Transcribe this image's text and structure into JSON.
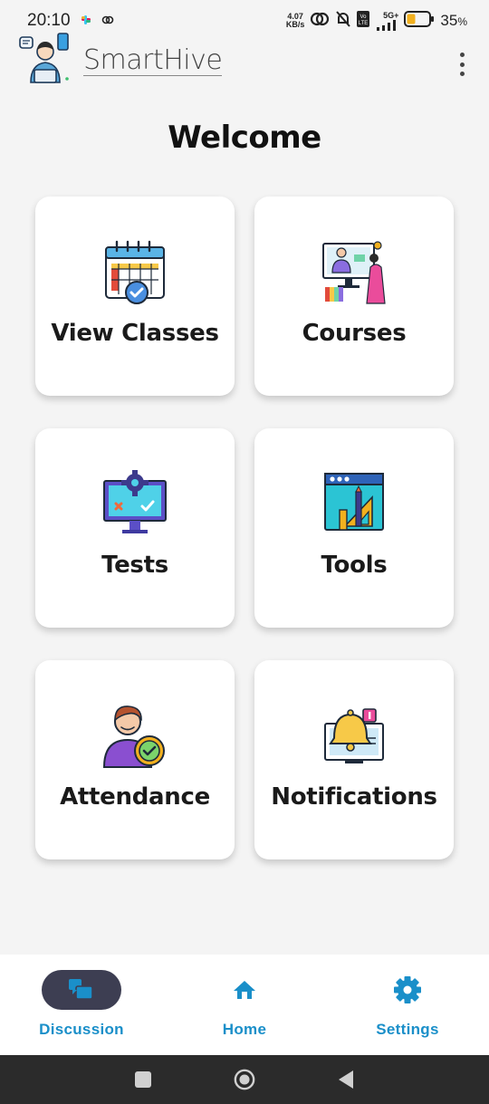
{
  "status_bar": {
    "time": "20:10",
    "net_speed_value": "4.07",
    "net_speed_unit": "KB/s",
    "network": "5G+",
    "battery_percent": "35",
    "battery_unit": "%"
  },
  "header": {
    "app_title": "SmartHive",
    "menu_icon": "more-vertical-icon"
  },
  "main": {
    "welcome": "Welcome",
    "cards": [
      {
        "label": "View Classes",
        "icon": "calendar-check-icon"
      },
      {
        "label": "Courses",
        "icon": "online-class-icon"
      },
      {
        "label": "Tests",
        "icon": "monitor-test-icon"
      },
      {
        "label": "Tools",
        "icon": "design-tools-icon"
      },
      {
        "label": "Attendance",
        "icon": "user-check-icon"
      },
      {
        "label": "Notifications",
        "icon": "bell-notification-icon"
      }
    ]
  },
  "bottom_nav": {
    "items": [
      {
        "label": "Discussion",
        "icon": "discussion-icon",
        "active": true
      },
      {
        "label": "Home",
        "icon": "home-icon",
        "active": false
      },
      {
        "label": "Settings",
        "icon": "gear-icon",
        "active": false
      }
    ]
  },
  "colors": {
    "accent": "#1a8fc9",
    "active_pill": "#3d3e52",
    "background": "#f4f4f4",
    "system_nav": "#2b2b2b"
  }
}
